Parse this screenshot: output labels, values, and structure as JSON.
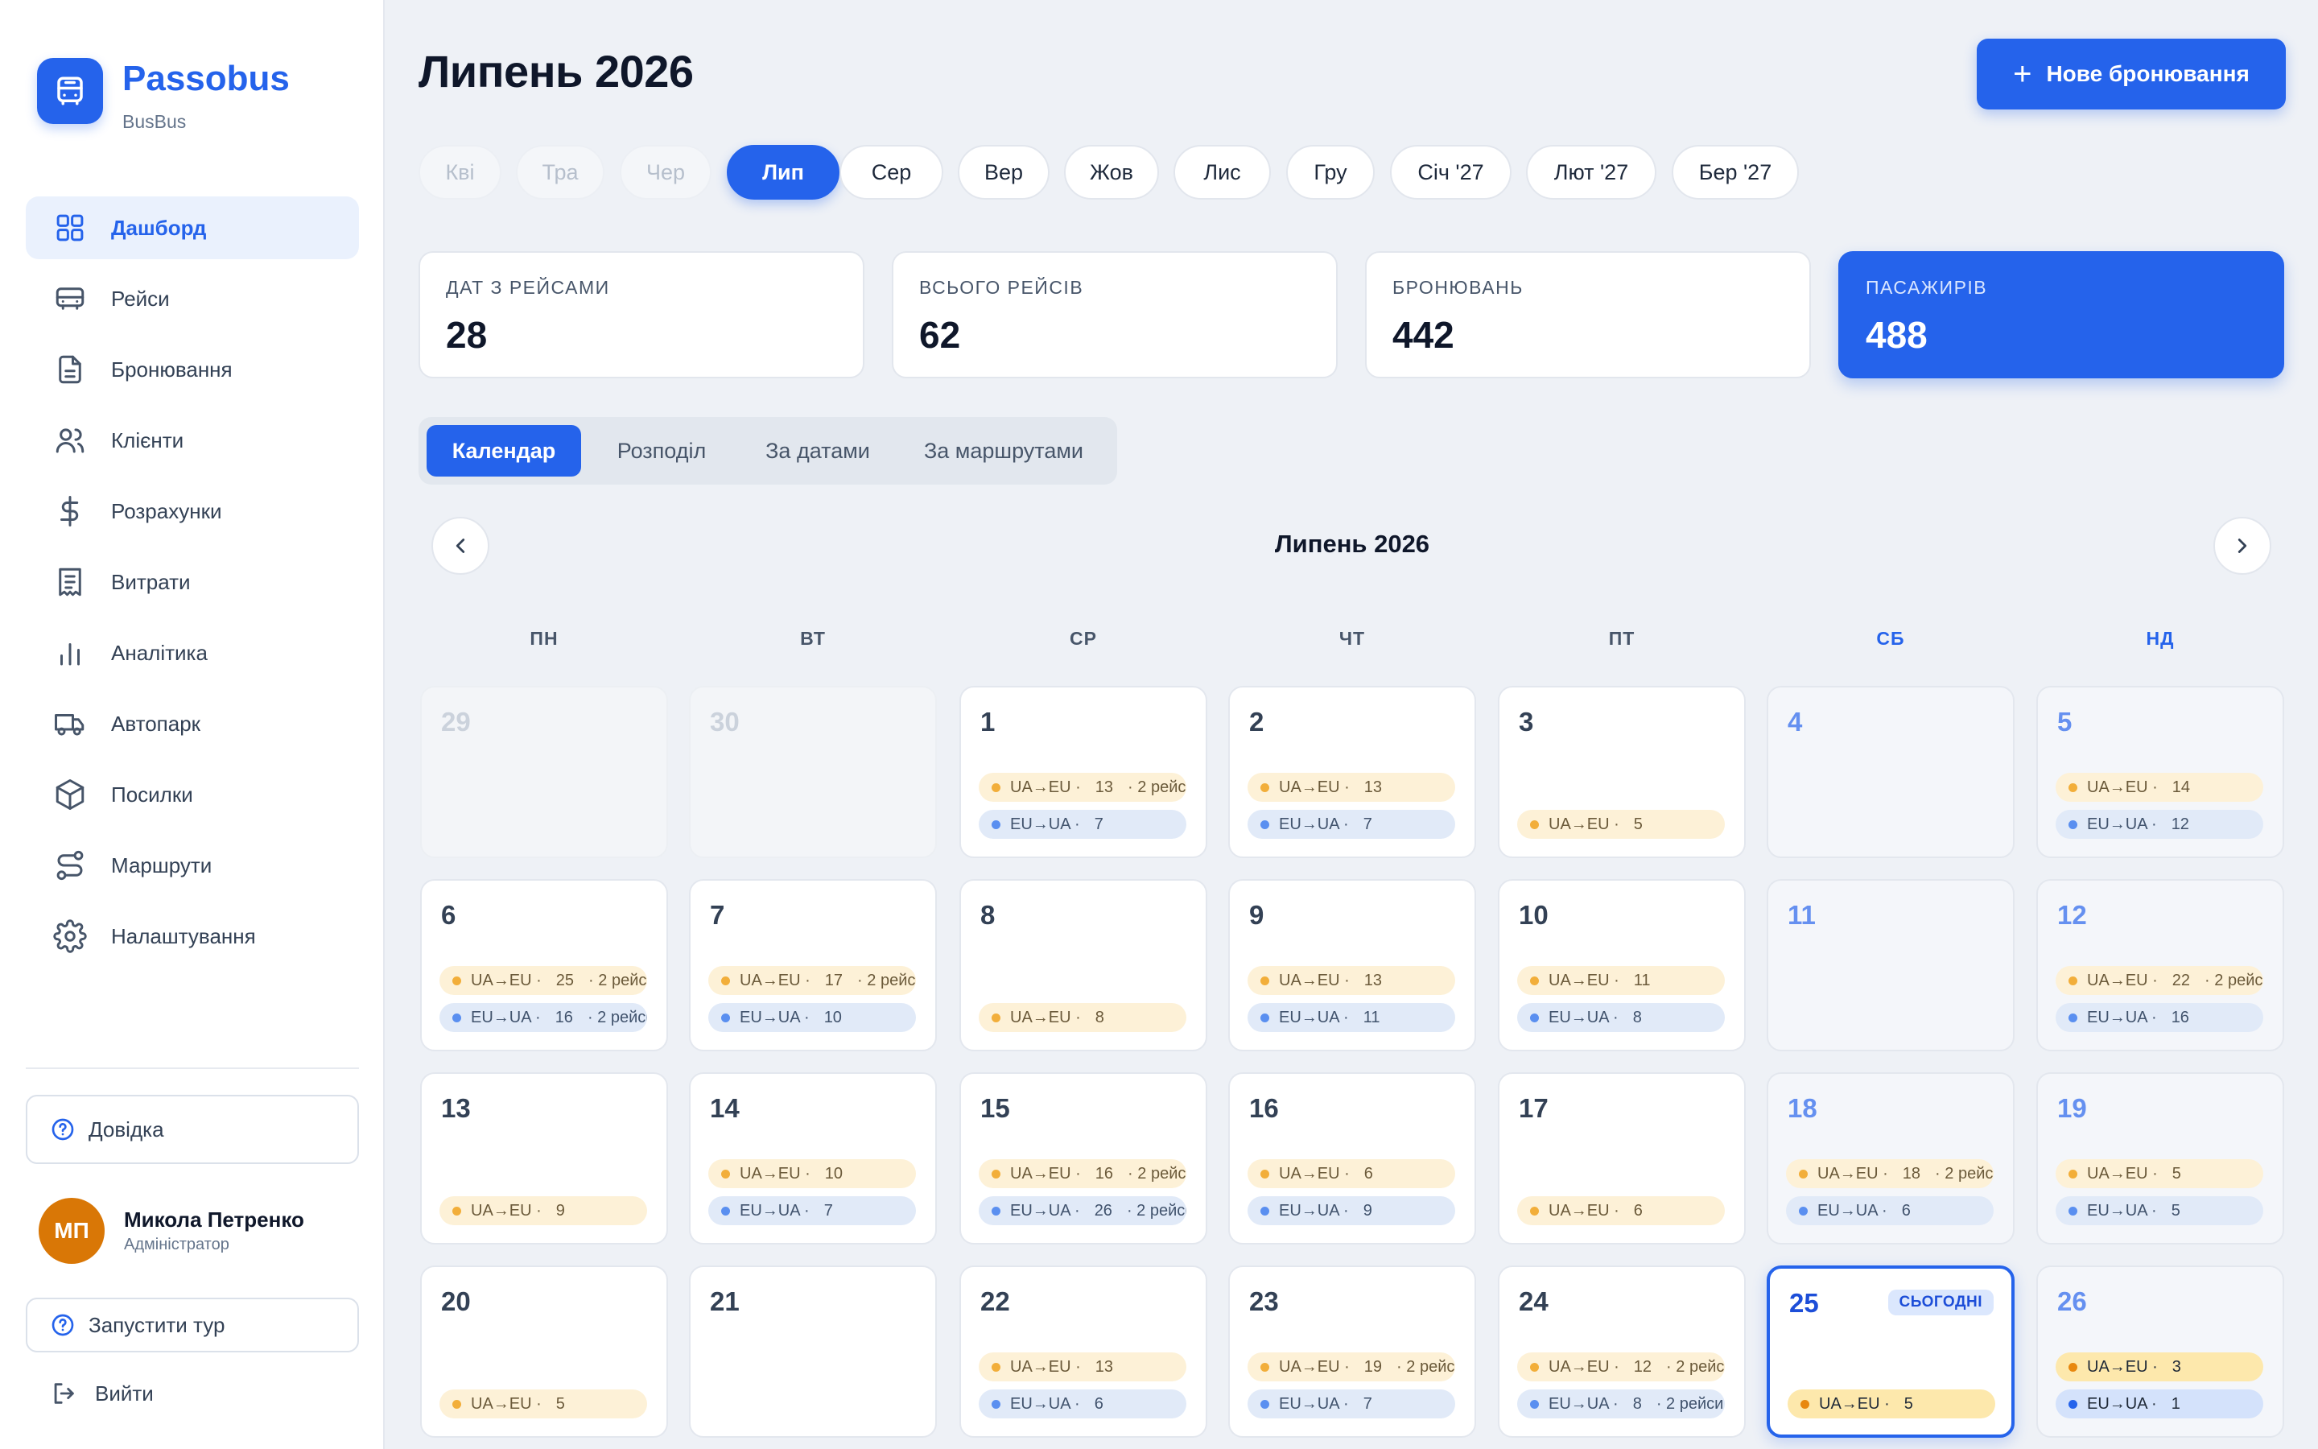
{
  "brand": {
    "name": "Passobus",
    "subtitle": "BusBus"
  },
  "nav": [
    {
      "label": "Дашборд",
      "icon": "grid-icon",
      "active": true
    },
    {
      "label": "Рейси",
      "icon": "bus-icon"
    },
    {
      "label": "Бронювання",
      "icon": "document-icon"
    },
    {
      "label": "Клієнти",
      "icon": "users-icon"
    },
    {
      "label": "Розрахунки",
      "icon": "dollar-icon"
    },
    {
      "label": "Витрати",
      "icon": "receipt-icon"
    },
    {
      "label": "Аналітика",
      "icon": "chart-bars-icon"
    },
    {
      "label": "Автопарк",
      "icon": "truck-icon"
    },
    {
      "label": "Посилки",
      "icon": "package-icon"
    },
    {
      "label": "Маршрути",
      "icon": "route-icon"
    },
    {
      "label": "Налаштування",
      "icon": "gear-icon"
    }
  ],
  "help_label": "Довідка",
  "user": {
    "initials": "МП",
    "name": "Микола Петренко",
    "role": "Адміністратор"
  },
  "tour_label": "Запустити тур",
  "logout_label": "Вийти",
  "page_title": "Липень 2026",
  "new_booking_label": "Нове бронювання",
  "months": [
    {
      "label": "Кві",
      "state": "disabled"
    },
    {
      "label": "Тра",
      "state": "disabled"
    },
    {
      "label": "Чер",
      "state": "disabled"
    },
    {
      "label": "Лип",
      "state": "active"
    },
    {
      "label": "Сер",
      "state": "normal"
    },
    {
      "label": "Вер",
      "state": "normal"
    },
    {
      "label": "Жов",
      "state": "normal"
    },
    {
      "label": "Лис",
      "state": "normal"
    },
    {
      "label": "Гру",
      "state": "normal"
    },
    {
      "label": "Січ '27",
      "state": "normal"
    },
    {
      "label": "Лют '27",
      "state": "normal"
    },
    {
      "label": "Бер '27",
      "state": "normal"
    }
  ],
  "stats": [
    {
      "label": "ДАТ З РЕЙСАМИ",
      "value": "28"
    },
    {
      "label": "ВСЬОГО РЕЙСІВ",
      "value": "62"
    },
    {
      "label": "БРОНЮВАНЬ",
      "value": "442"
    },
    {
      "label": "ПАСАЖИРІВ",
      "value": "488",
      "primary": true
    }
  ],
  "view_tabs": [
    {
      "label": "Календар",
      "active": true
    },
    {
      "label": "Розподіл"
    },
    {
      "label": "За датами"
    },
    {
      "label": "За маршрутами"
    }
  ],
  "calendar": {
    "title": "Липень 2026",
    "weekdays": [
      "ПН",
      "ВТ",
      "СР",
      "ЧТ",
      "ПТ",
      "СБ",
      "НД"
    ],
    "today_label": "СЬОГОДНІ",
    "ua_label": "UA→EU ·",
    "eu_label": "EU→UA ·",
    "trips_suffix": "· 2 рейси",
    "days": [
      {
        "n": "29",
        "other": true
      },
      {
        "n": "30",
        "other": true
      },
      {
        "n": "1",
        "ua": "13",
        "ua_trips": true,
        "eu": "7"
      },
      {
        "n": "2",
        "ua": "13",
        "eu": "7"
      },
      {
        "n": "3",
        "ua": "5"
      },
      {
        "n": "4"
      },
      {
        "n": "5",
        "ua": "14",
        "eu": "12"
      },
      {
        "n": "6",
        "ua": "25",
        "ua_trips": true,
        "eu": "16",
        "eu_trips": true
      },
      {
        "n": "7",
        "ua": "17",
        "ua_trips": true,
        "eu": "10"
      },
      {
        "n": "8",
        "ua": "8"
      },
      {
        "n": "9",
        "ua": "13",
        "eu": "11"
      },
      {
        "n": "10",
        "ua": "11",
        "eu": "8"
      },
      {
        "n": "11"
      },
      {
        "n": "12",
        "ua": "22",
        "ua_trips": true,
        "eu": "16"
      },
      {
        "n": "13",
        "ua": "9"
      },
      {
        "n": "14",
        "ua": "10",
        "eu": "7"
      },
      {
        "n": "15",
        "ua": "16",
        "ua_trips": true,
        "eu": "26",
        "eu_trips": true
      },
      {
        "n": "16",
        "ua": "6",
        "eu": "9"
      },
      {
        "n": "17",
        "ua": "6"
      },
      {
        "n": "18",
        "ua": "18",
        "ua_trips": true,
        "eu": "6"
      },
      {
        "n": "19",
        "ua": "5",
        "eu": "5"
      },
      {
        "n": "20",
        "ua": "5"
      },
      {
        "n": "21"
      },
      {
        "n": "22",
        "ua": "13",
        "eu": "6"
      },
      {
        "n": "23",
        "ua": "19",
        "ua_trips": true,
        "eu": "7"
      },
      {
        "n": "24",
        "ua": "12",
        "ua_trips": true,
        "eu": "8",
        "eu_trips": true
      },
      {
        "n": "25",
        "ua": "5",
        "today": true
      },
      {
        "n": "26",
        "ua": "3",
        "eu": "1",
        "strong": true
      }
    ]
  }
}
